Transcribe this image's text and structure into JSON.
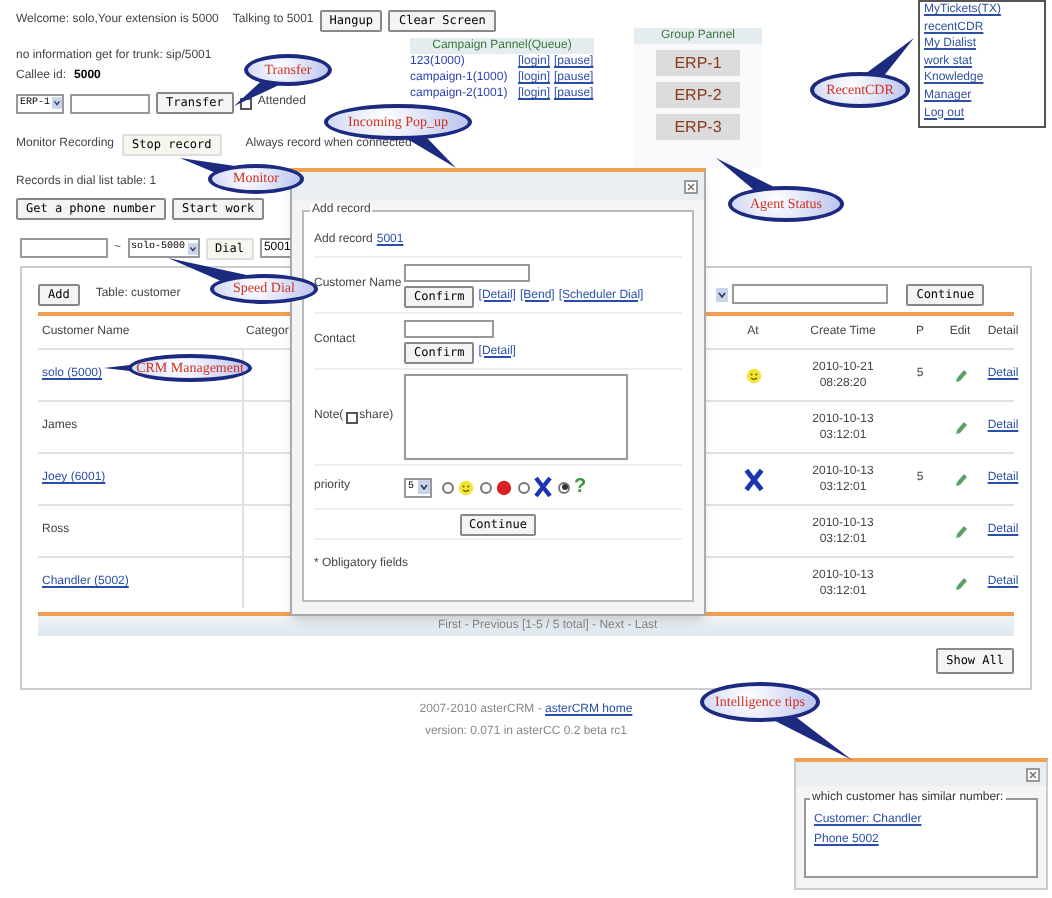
{
  "header": {
    "welcome": "Welcome: solo,Your extension is 5000",
    "talking": "Talking to 5001",
    "buttons": [
      "Hangup",
      "Clear Screen"
    ]
  },
  "trunk_info": "no information get for trunk: sip/5001",
  "callee": {
    "label": "Callee id:",
    "value": "5000"
  },
  "transfer": {
    "select": "ERP-1",
    "button": "Transfer",
    "attended_label": "Attended",
    "attended_checked": false
  },
  "monitor": {
    "label": "Monitor Recording",
    "button": "Stop record",
    "button_disabled": true,
    "note": "Always record when connected"
  },
  "dial_list": {
    "text": "Records in dial list table: 1",
    "buttons": [
      "Get a phone number",
      "Start work"
    ]
  },
  "campaign_panel": {
    "title": "Campaign Pannel(Queue)",
    "rows": [
      {
        "name": "123(1000)",
        "actions": [
          "[login]",
          "[pause]"
        ]
      },
      {
        "name": "campaign-1(1000)",
        "actions": [
          "[login]",
          "[pause]"
        ]
      },
      {
        "name": "campaign-2(1001)",
        "actions": [
          "[login]",
          "[pause]"
        ]
      }
    ]
  },
  "group_panel": {
    "title": "Group Pannel",
    "agents": [
      "ERP-1",
      "ERP-2",
      "ERP-3"
    ]
  },
  "menu": [
    "MyTickets(TX)",
    "recentCDR",
    "My Dialist",
    "work stat",
    "Knowledge",
    "Manager",
    "Log out"
  ],
  "speed_dial": {
    "separator": "~",
    "select": "solo-5000",
    "button": "Dial",
    "button_disabled": true,
    "number": "5001"
  },
  "table": {
    "add": "Add",
    "caption": "Table: customer",
    "search_button": "Continue",
    "columns": [
      "Customer Name",
      "Categor",
      "At",
      "Create Time",
      "P",
      "Edit",
      "Detail"
    ],
    "rows": [
      {
        "name": "solo (5000)",
        "linked": true,
        "kind": "smile",
        "date": "2010-10-21",
        "time": "08:28:20",
        "p": "5",
        "detail": "Detail"
      },
      {
        "name": "James",
        "linked": false,
        "kind": "plain",
        "date": "2010-10-13",
        "time": "03:12:01",
        "detail": "Detail"
      },
      {
        "name": "Joey (6001)",
        "linked": true,
        "kind": "x",
        "date": "2010-10-13",
        "time": "03:12:01",
        "p": "5",
        "detail": "Detail"
      },
      {
        "name": "Ross",
        "linked": false,
        "kind": "plain",
        "date": "2010-10-13",
        "time": "03:12:01",
        "detail": "Detail"
      },
      {
        "name": "Chandler (5002)",
        "linked": true,
        "kind": "plain",
        "date": "2010-10-13",
        "time": "03:12:01",
        "detail": "Detail"
      }
    ],
    "pager": "First - Previous [1-5 / 5 total] - Next - Last",
    "show_all": "Show All"
  },
  "footer": {
    "copyright": "2007-2010 asterCRM - ",
    "link": "asterCRM home",
    "version": "version: 0.071 in asterCC 0.2 beta rc1"
  },
  "dialog": {
    "legend": "Add record",
    "add_record": "Add record",
    "number": "5001",
    "customer_label": "Customer Name",
    "customer_confirm": "Confirm",
    "customer_links": [
      "[Detail]",
      "[Bend]",
      "[Scheduler Dial]"
    ],
    "contact_label": "Contact",
    "contact_confirm": "Confirm",
    "contact_links": [
      "[Detail]"
    ],
    "note_label": "Note(",
    "share_label": "share)",
    "share_checked": false,
    "priority_label": "priority",
    "priority": "5",
    "options": [
      {
        "kind": "smile",
        "selected": false
      },
      {
        "kind": "red",
        "selected": false
      },
      {
        "kind": "x",
        "selected": false
      },
      {
        "kind": "question",
        "label": "?",
        "selected": true
      }
    ],
    "continue": "Continue",
    "footnote": "* Obligatory fields"
  },
  "tips": {
    "legend": "which customer has similar number:",
    "links": [
      "Customer: Chandler",
      "Phone 5002"
    ]
  },
  "callouts": [
    "Transfer",
    "Incoming Pop_up",
    "Monitor",
    "Speed Dial",
    "CRM Management",
    "RecentCDR",
    "Agent Status",
    "Intelligence tips"
  ]
}
